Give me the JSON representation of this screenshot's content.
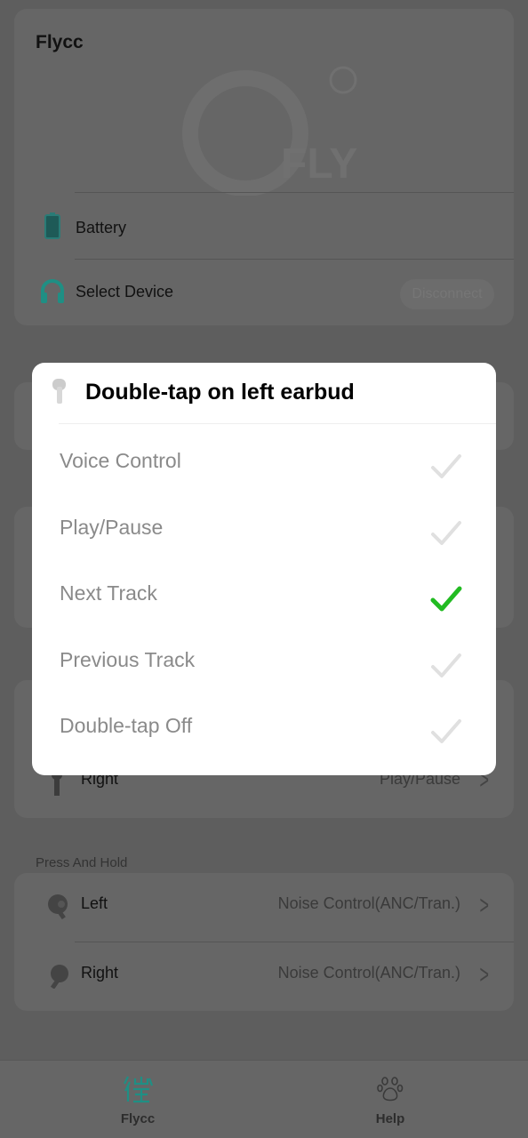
{
  "header": {
    "title": "Flycc",
    "logo_text": "FLY"
  },
  "device": {
    "battery_label": "Battery",
    "select_device_label": "Select Device",
    "disconnect_label": "Disconnect"
  },
  "double_tap_behind": {
    "right_label": "Right",
    "right_value": "Play/Pause"
  },
  "press_and_hold": {
    "section_label": "Press And Hold",
    "left_label": "Left",
    "left_value": "Noise Control(ANC/Tran.)",
    "right_label": "Right",
    "right_value": "Noise Control(ANC/Tran.)"
  },
  "dialog": {
    "title": "Double-tap on left earbud",
    "options": [
      {
        "label": "Voice Control",
        "selected": false
      },
      {
        "label": "Play/Pause",
        "selected": false
      },
      {
        "label": "Next Track",
        "selected": true
      },
      {
        "label": "Previous Track",
        "selected": false
      },
      {
        "label": "Double-tap Off",
        "selected": false
      }
    ]
  },
  "nav": {
    "items": [
      {
        "label": "Flycc",
        "icon": "flycc-icon",
        "active": true
      },
      {
        "label": "Help",
        "icon": "paw-icon",
        "active": false
      }
    ]
  },
  "colors": {
    "accent": "#1f8f84",
    "check_selected": "#22bb22",
    "check_unselected": "#e0e0e0"
  }
}
